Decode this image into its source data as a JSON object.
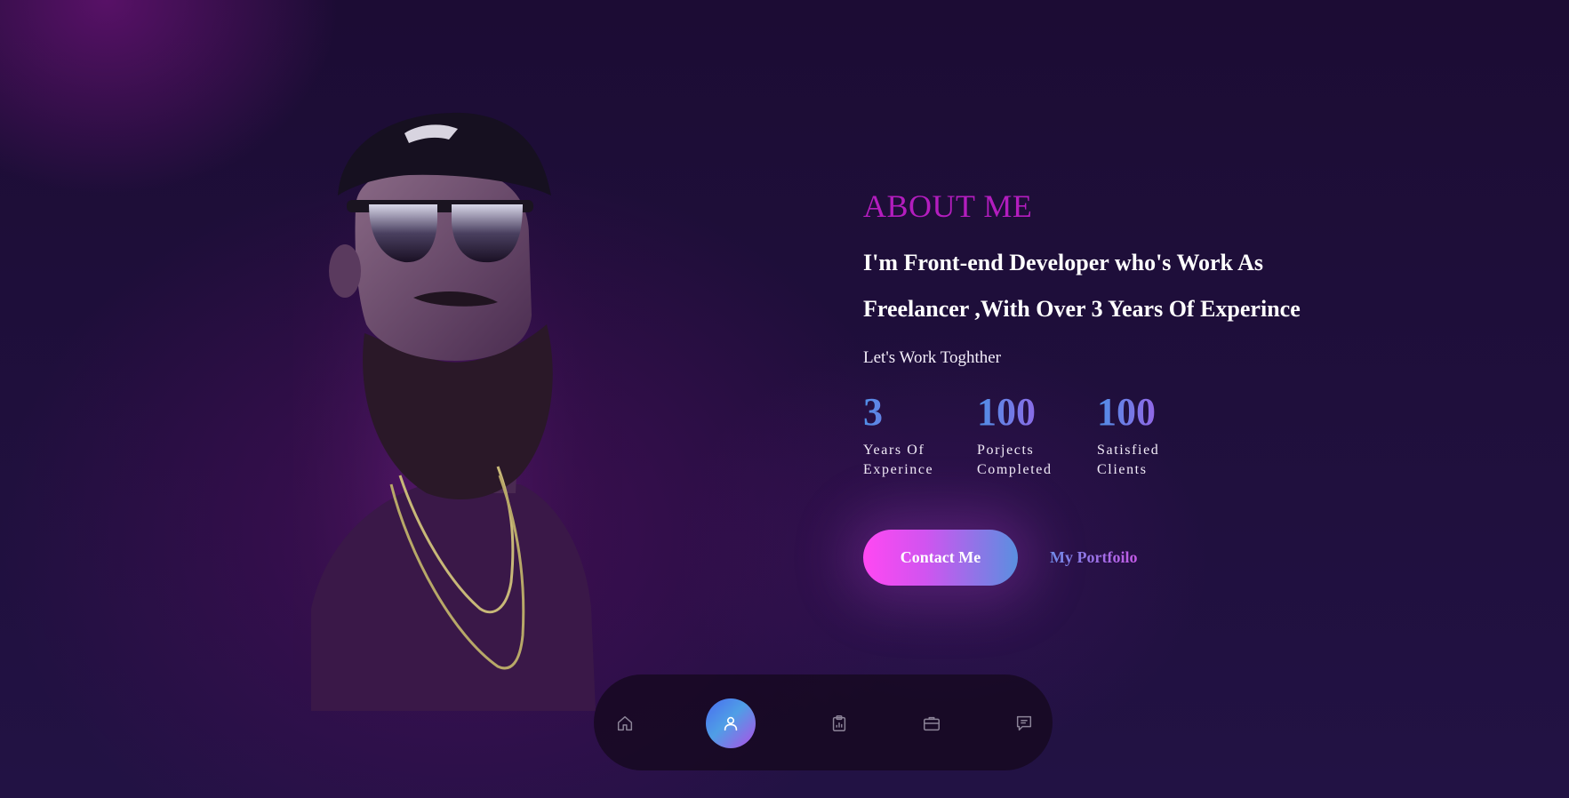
{
  "about": {
    "title": "ABOUT ME",
    "headline_line1": "I'm Front-end Developer who's Work As",
    "headline_line2": "Freelancer ,With Over 3 Years Of Experince",
    "tagline": "Let's Work Toghther"
  },
  "stats": [
    {
      "value": "3",
      "label_line1": "Years Of",
      "label_line2": "Experince"
    },
    {
      "value": "100",
      "label_line1": "Porjects",
      "label_line2": "Completed"
    },
    {
      "value": "100",
      "label_line1": "Satisfied",
      "label_line2": "Clients"
    }
  ],
  "actions": {
    "contact_label": "Contact Me",
    "portfolio_label": "My Portfoilo"
  },
  "nav": {
    "items": [
      {
        "icon": "home-icon",
        "active": false
      },
      {
        "icon": "user-icon",
        "active": true
      },
      {
        "icon": "clipboard-chart-icon",
        "active": false
      },
      {
        "icon": "briefcase-icon",
        "active": false
      },
      {
        "icon": "message-icon",
        "active": false
      }
    ]
  },
  "colors": {
    "title_accent": "#b31dbe",
    "button_gradient_start": "#ff48f2",
    "button_gradient_end": "#5a8fe0",
    "background": "#1f0f3c"
  }
}
